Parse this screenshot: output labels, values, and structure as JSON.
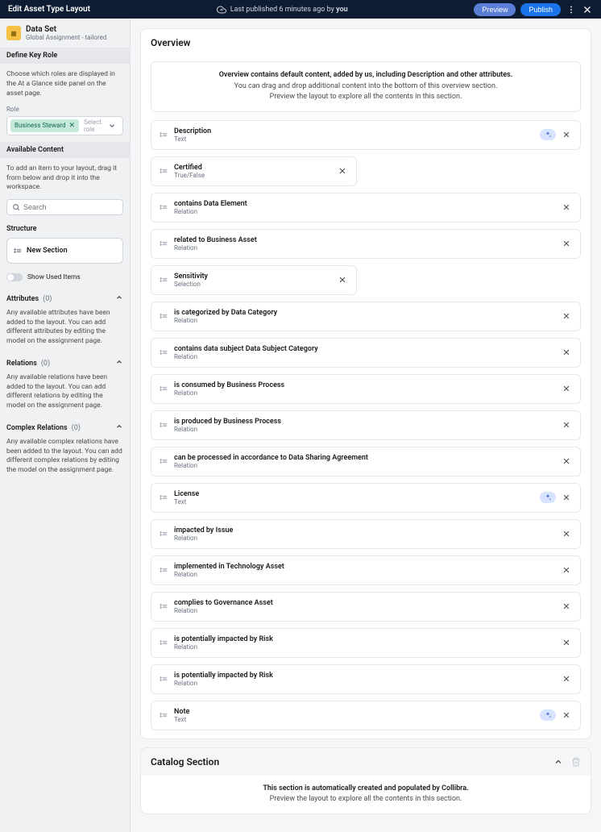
{
  "topbar": {
    "title": "Edit Asset Type Layout",
    "published_prefix": "Last published 6 minutes ago by ",
    "published_by": "you",
    "preview": "Preview",
    "publish": "Publish"
  },
  "asset": {
    "name": "Data Set",
    "scope": "Global Assignment - tailored"
  },
  "sidebar": {
    "define_role_head": "Define Key Role",
    "define_role_desc": "Choose which roles are displayed in the At a Glance side panel on the asset page.",
    "role_label": "Role",
    "role_chip": "Business Steward",
    "role_placeholder": "Select role",
    "available_content_head": "Available Content",
    "available_content_desc": "To add an item to your layout, drag it from below and drop it into the workspace.",
    "search_placeholder": "Search",
    "structure_head": "Structure",
    "new_section": "New Section",
    "show_used": "Show Used Items",
    "attributes": {
      "title": "Attributes",
      "count": "(0)",
      "desc": "Any available attributes have been added to the layout. You can add different attributes by editing the model on the assignment page."
    },
    "relations": {
      "title": "Relations",
      "count": "(0)",
      "desc": "Any available relations have been added to the layout. You can add different relations by editing the model on the assignment page."
    },
    "complex": {
      "title": "Complex Relations",
      "count": "(0)",
      "desc": "Any available complex relations have been added to the layout. You can add different complex relations by editing the model on the assignment page."
    }
  },
  "overview": {
    "title": "Overview",
    "desc_bold": "Overview contains default content, added by us, including Description and other attributes.",
    "desc_l2": "You can drag and drop additional content into the bottom of this overview section.",
    "desc_l3": "Preview the layout to explore all the contents in this section.",
    "cards": [
      {
        "title": "Description",
        "type": "Text",
        "half": false,
        "ai": true,
        "close": true
      },
      {
        "title": "Certified",
        "type": "True/False",
        "half": true,
        "ai": false,
        "close": true
      },
      {
        "title": "contains Data Element",
        "type": "Relation",
        "half": false,
        "ai": false,
        "close": true
      },
      {
        "title": "related to Business Asset",
        "type": "Relation",
        "half": false,
        "ai": false,
        "close": true
      },
      {
        "title": "Sensitivity",
        "type": "Selection",
        "half": true,
        "ai": false,
        "close": true
      },
      {
        "title": "is categorized by Data Category",
        "type": "Relation",
        "half": false,
        "ai": false,
        "close": true
      },
      {
        "title": "contains data subject Data Subject Category",
        "type": "Relation",
        "half": false,
        "ai": false,
        "close": true
      },
      {
        "title": "is consumed by Business Process",
        "type": "Relation",
        "half": false,
        "ai": false,
        "close": true
      },
      {
        "title": "is produced by Business Process",
        "type": "Relation",
        "half": false,
        "ai": false,
        "close": true
      },
      {
        "title": "can be processed in accordance to Data Sharing Agreement",
        "type": "Relation",
        "half": false,
        "ai": false,
        "close": true
      },
      {
        "title": "License",
        "type": "Text",
        "half": false,
        "ai": true,
        "close": true
      },
      {
        "title": "impacted by Issue",
        "type": "Relation",
        "half": false,
        "ai": false,
        "close": true
      },
      {
        "title": "implemented in Technology Asset",
        "type": "Relation",
        "half": false,
        "ai": false,
        "close": true
      },
      {
        "title": "complies to Governance Asset",
        "type": "Relation",
        "half": false,
        "ai": false,
        "close": true
      },
      {
        "title": "is potentially impacted by Risk",
        "type": "Relation",
        "half": false,
        "ai": false,
        "close": true
      },
      {
        "title": "is potentially impacted by Risk",
        "type": "Relation",
        "half": false,
        "ai": false,
        "close": true
      },
      {
        "title": "Note",
        "type": "Text",
        "half": false,
        "ai": true,
        "close": true
      }
    ]
  },
  "catalog": {
    "title": "Catalog Section",
    "l1": "This section is automatically created and populated by Collibra.",
    "l2": "Preview the layout to explore all the contents in this section."
  }
}
